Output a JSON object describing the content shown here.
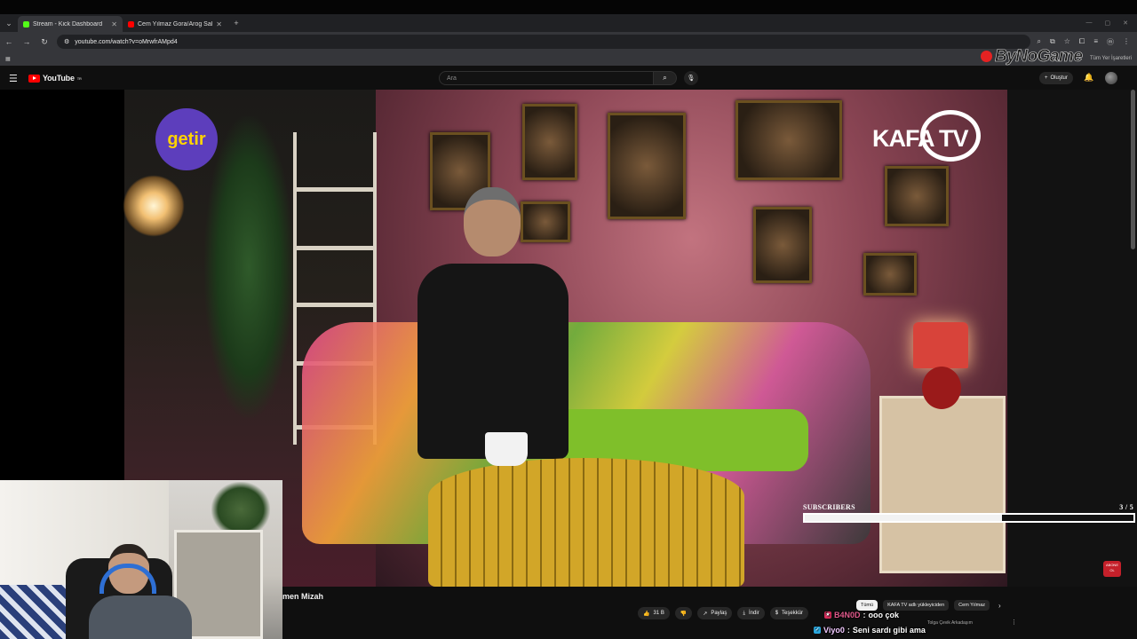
{
  "browser": {
    "tabs": [
      {
        "title": "Stream - Kick Dashboard",
        "favicon_color": "#53fc18"
      },
      {
        "title": "Cem Yılmaz Gora/Arog Sahnele...",
        "favicon_color": "#ff0000"
      }
    ],
    "new_tab": "+",
    "url": "youtube.com/watch?v=oMrwfrAMpd4",
    "bookmarks_all": "Tüm Yer İşaretleri"
  },
  "watermark": "ByNoGame",
  "youtube": {
    "logo_text": "YouTube",
    "region": "TR",
    "search_placeholder": "Ara",
    "create_label": "Oluştur"
  },
  "video": {
    "sponsor_logo": "getir",
    "channel_logo": "KAFA TV",
    "title": "men Mizah",
    "actions": [
      {
        "icon": "thumbs-up-icon",
        "label": "31 B"
      },
      {
        "icon": "thumbs-down-icon",
        "label": ""
      },
      {
        "icon": "share-icon",
        "label": "Paylaş"
      },
      {
        "icon": "download-icon",
        "label": "İndir"
      },
      {
        "icon": "thanks-icon",
        "label": "Teşekkür"
      }
    ]
  },
  "overlay": {
    "label": "SUBSCRIBERS",
    "count": "3  / 5",
    "progress": 0.6,
    "badge": "ABONE OL"
  },
  "chips": {
    "items": [
      "Tümü",
      "KAFA TV adlı yükleyiciden",
      "Cem Yılmaz"
    ],
    "selected": 0,
    "recommendation": "Tolga Çevik Arkadaşım"
  },
  "chat": [
    {
      "user": "B4N0D",
      "text": "ooo çok"
    },
    {
      "user": "Viyo0",
      "text": "Seni sardı gibi ama"
    }
  ]
}
